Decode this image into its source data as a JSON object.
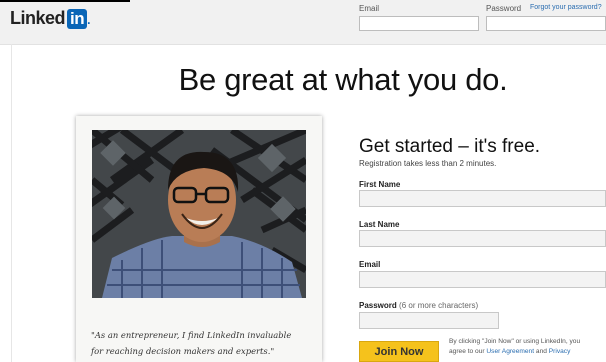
{
  "header": {
    "logo_text": "Linked",
    "logo_in": "in",
    "email_label": "Email",
    "password_label": "Password",
    "forgot_link": "Forgot your password?"
  },
  "hero": {
    "headline": "Be great at what you do."
  },
  "card": {
    "quote_line1": "\"As an entrepreneur, I find LinkedIn invaluable",
    "quote_line2": "for reaching decision makers and experts.\""
  },
  "signup": {
    "title": "Get started – it's free.",
    "subtitle": "Registration takes less than 2 minutes.",
    "first_name_label": "First Name",
    "last_name_label": "Last Name",
    "email_label": "Email",
    "password_label": "Password",
    "password_hint": "(6 or more characters)",
    "join_button": "Join Now",
    "terms_line1": "By clicking \"Join Now\" or using LinkedIn, you",
    "terms_line2": "agree to our",
    "user_agreement": "User Agreement",
    "terms_and": "and",
    "privacy": "Privacy"
  },
  "colors": {
    "brand_blue": "#0a66b7",
    "join_button": "#f5c21c",
    "link": "#2a6db0"
  }
}
